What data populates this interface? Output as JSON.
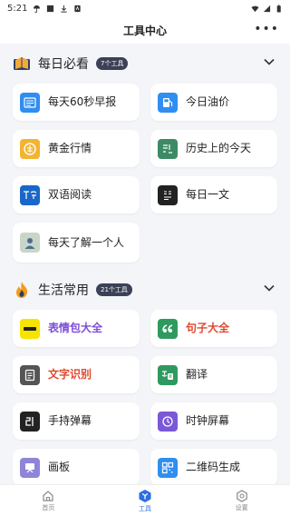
{
  "status": {
    "time": "5:21"
  },
  "header": {
    "title": "工具中心",
    "more": "•••"
  },
  "sections": [
    {
      "title": "每日必看",
      "badge": "7个工具",
      "items": [
        {
          "label": "每天60秒早报",
          "icon": "newspaper-icon",
          "color": "#2f8ef0"
        },
        {
          "label": "今日油价",
          "icon": "gas-pump-icon",
          "color": "#2f8ef0"
        },
        {
          "label": "黄金行情",
          "icon": "gold-icon",
          "color": "#f3b431"
        },
        {
          "label": "历史上的今天",
          "icon": "history-icon",
          "color": "#3d8a66"
        },
        {
          "label": "双语阅读",
          "icon": "bilingual-icon",
          "color": "#1a67c9"
        },
        {
          "label": "每日一文",
          "icon": "article-icon",
          "color": "#222222"
        },
        {
          "label": "每天了解一个人",
          "icon": "person-icon",
          "color": "#c7d6c9"
        }
      ]
    },
    {
      "title": "生活常用",
      "badge": "21个工具",
      "items": [
        {
          "label": "表情包大全",
          "icon": "emoji-pack-icon",
          "color": "#f6e400"
        },
        {
          "label": "句子大全",
          "icon": "quote-icon",
          "color": "#2f9a5f"
        },
        {
          "label": "文字识别",
          "icon": "text-scan-icon",
          "color": "#555555"
        },
        {
          "label": "翻译",
          "icon": "translate-icon",
          "color": "#2f9a5f"
        },
        {
          "label": "手持弹幕",
          "icon": "barrage-icon",
          "color": "#222222"
        },
        {
          "label": "时钟屏幕",
          "icon": "clock-icon",
          "color": "#7a58d6"
        },
        {
          "label": "画板",
          "icon": "drawing-board-icon",
          "color": "#8f85d8"
        },
        {
          "label": "二维码生成",
          "icon": "qrcode-icon",
          "color": "#2f8ef0"
        }
      ]
    }
  ],
  "tabs": [
    {
      "label": "首页",
      "icon": "home-icon"
    },
    {
      "label": "工具",
      "icon": "tools-icon"
    },
    {
      "label": "设置",
      "icon": "settings-icon"
    }
  ]
}
